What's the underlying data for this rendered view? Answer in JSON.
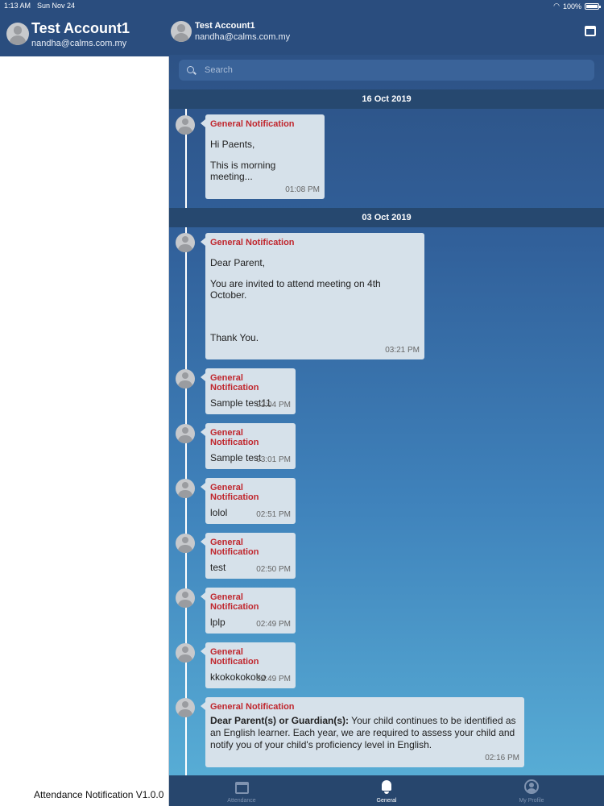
{
  "status_bar": {
    "time": "1:13 AM",
    "date": "Sun Nov 24",
    "battery": "100%"
  },
  "sidebar": {
    "name": "Test Account1",
    "email": "nandha@calms.com.my",
    "version": "Attendance Notification V1.0.0"
  },
  "header": {
    "name": "Test Account1",
    "email": "nandha@calms.com.my"
  },
  "search": {
    "placeholder": "Search"
  },
  "date_groups": [
    {
      "date": "16 Oct 2019",
      "messages": [
        {
          "title": "General Notification",
          "lines": [
            "Hi Paents,",
            "This is morning meeting..."
          ],
          "time": "01:08 PM"
        }
      ]
    },
    {
      "date": "03 Oct 2019",
      "messages": [
        {
          "title": "General Notification",
          "lines": [
            "Dear Parent,",
            "You are invited to attend meeting on 4th October.",
            "Thank You."
          ],
          "time": "03:21 PM"
        },
        {
          "title": "General Notification",
          "lines": [
            "Sample test11"
          ],
          "time": "03:04 PM"
        },
        {
          "title": "General Notification",
          "lines": [
            "Sample test"
          ],
          "time": "03:01 PM"
        },
        {
          "title": "General Notification",
          "lines": [
            "lolol"
          ],
          "time": "02:51 PM"
        },
        {
          "title": "General Notification",
          "lines": [
            "test"
          ],
          "time": "02:50 PM"
        },
        {
          "title": "General Notification",
          "lines": [
            "lplp"
          ],
          "time": "02:49 PM"
        },
        {
          "title": "General Notification",
          "lines": [
            "kkokokokoko"
          ],
          "time": "02:49 PM"
        },
        {
          "title": "General Notification",
          "bold_prefix": "Dear Parent(s) or Guardian(s):",
          "lines": [
            " Your child continues to be identified as an English learner. Each year, we are required to assess your child and notify you of your child's proficiency level in English."
          ],
          "time": "02:16 PM"
        }
      ]
    }
  ],
  "tabs": [
    {
      "label": "Attendance",
      "icon": "calendar-icon"
    },
    {
      "label": "General",
      "icon": "bell-icon"
    },
    {
      "label": "My Profile",
      "icon": "profile-icon"
    }
  ],
  "colors": {
    "header": "#2a4d7e",
    "date_bar": "#26486f",
    "title_red": "#c0262d",
    "bubble": "#d6e1ea"
  }
}
